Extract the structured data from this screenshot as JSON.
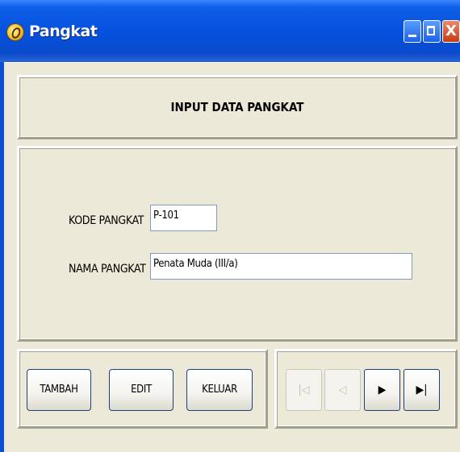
{
  "window": {
    "title": "Pangkat",
    "icon": "vb-app-icon",
    "controls": {
      "minimize": "minimize-icon",
      "maximize": "maximize-icon",
      "close_glyph": "X"
    }
  },
  "header": {
    "title": "INPUT DATA PANGKAT"
  },
  "form": {
    "kode_label": "KODE PANGKAT",
    "kode_value": "P-101",
    "nama_label": "NAMA PANGKAT",
    "nama_value": "Penata Muda (III/a)"
  },
  "buttons": {
    "tambah": "TAMBAH",
    "edit": "EDIT",
    "keluar": "KELUAR"
  },
  "navigator": {
    "first": {
      "glyph": "|◁",
      "enabled": false
    },
    "prev": {
      "glyph": "◁",
      "enabled": false
    },
    "next": {
      "glyph": "▶",
      "enabled": true
    },
    "last": {
      "glyph": "▶|",
      "enabled": true
    }
  },
  "colors": {
    "titlebar": "#0550dc",
    "client_bg": "#ece9d8"
  }
}
